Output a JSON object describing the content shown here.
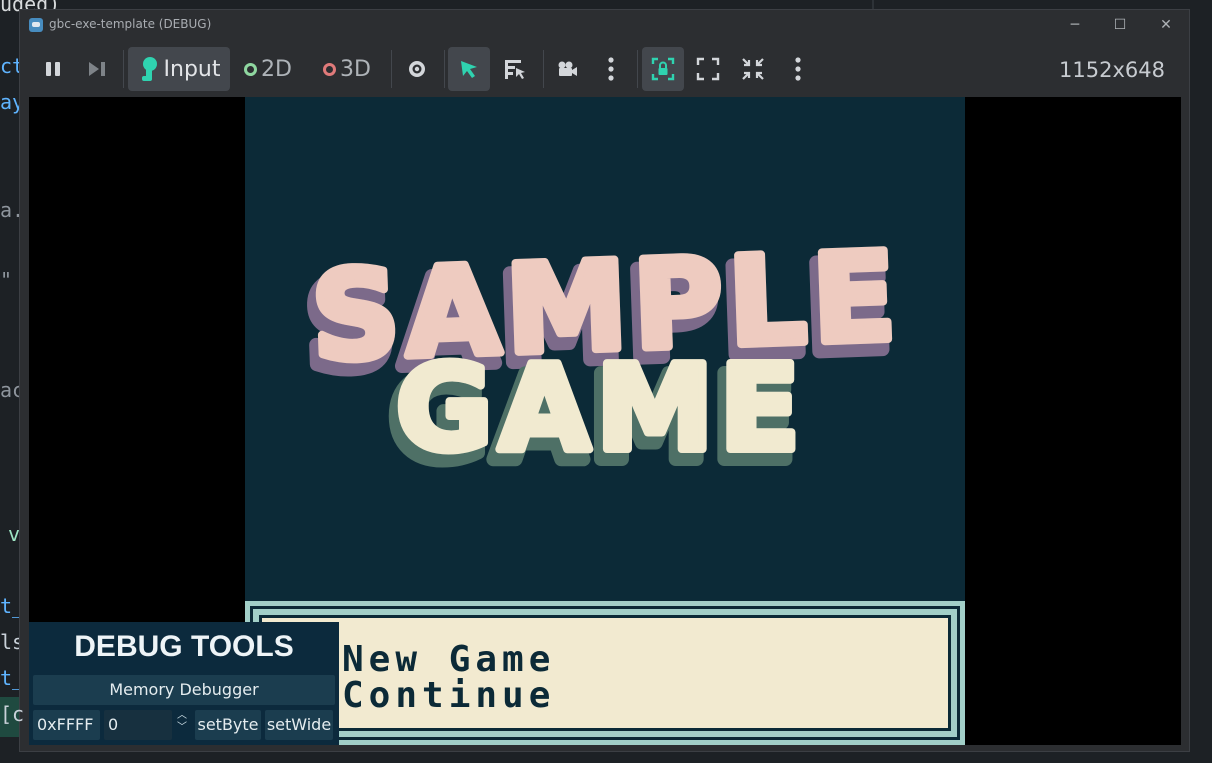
{
  "background_editor": {
    "top_text": "uded)",
    "fragments": [
      "ct",
      "ay",
      "a.",
      "\"",
      "ac",
      "v",
      "t_",
      "ls",
      "t_",
      "[c"
    ]
  },
  "window": {
    "title": "gbc-exe-template (DEBUG)",
    "controls": {
      "minimize": "─",
      "maximize": "☐",
      "close": "✕"
    }
  },
  "toolbar": {
    "input_label": "Input",
    "mode_2d_label": "2D",
    "mode_3d_label": "3D",
    "resolution": "1152x648",
    "colors": {
      "accent": "#2fd3b0",
      "ring_2d": "#8fd7a0",
      "ring_3d": "#e07a7a"
    }
  },
  "game": {
    "logo_line1": "SAMPLE",
    "logo_line2": "GAME",
    "menu": [
      "New Game",
      "Continue"
    ]
  },
  "debug_tools": {
    "title": "DEBUG TOOLS",
    "memory_debugger_label": "Memory Debugger",
    "address_value": "0xFFFF",
    "byte_value": "0",
    "set_byte_label": "setByte",
    "set_wide_label": "setWide"
  }
}
